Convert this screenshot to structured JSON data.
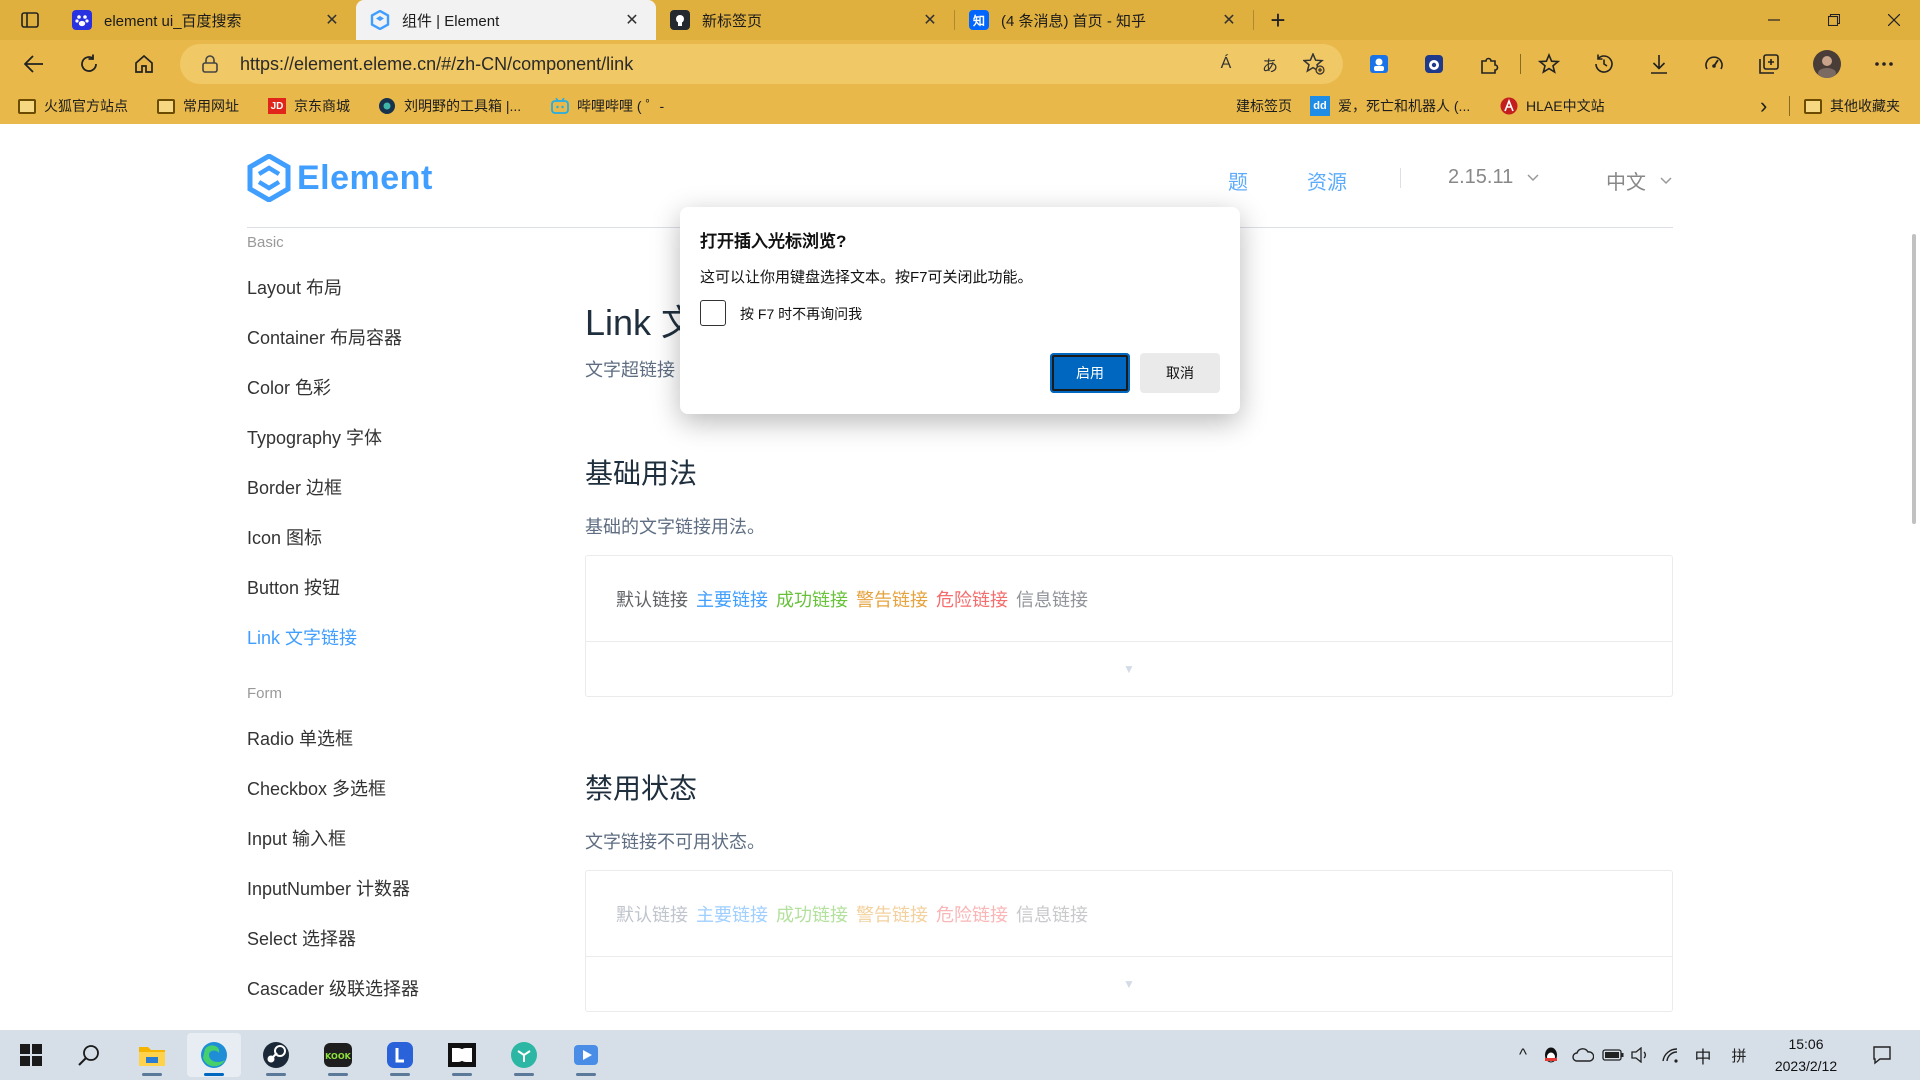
{
  "browser": {
    "tabs": [
      {
        "title": "element ui_百度搜索",
        "favicon": "baidu-paw-icon",
        "color": "#2932e1",
        "active": false
      },
      {
        "title": "组件 | Element",
        "favicon": "element-logo-icon",
        "color": "#409eff",
        "active": true
      },
      {
        "title": "新标签页",
        "favicon": "github-icon",
        "color": "#24292f",
        "active": false
      },
      {
        "title": "(4 条消息) 首页 - 知乎",
        "favicon": "zhihu-icon",
        "color": "#0066ff",
        "active": false
      }
    ],
    "tab_close_glyph": "✕",
    "new_tab_glyph": "+",
    "address": {
      "url": "https://element.eleme.cn/#/zh-CN/component/link"
    },
    "read_aloud_glyph": "Á",
    "translate_glyph": "あ",
    "bookmarks": [
      {
        "label": "火狐官方站点",
        "icon": "folder-icon"
      },
      {
        "label": "常用网址",
        "icon": "folder-icon"
      },
      {
        "label": "京东商城",
        "icon": "jd-icon"
      },
      {
        "label": "刘明野的工具箱 |...",
        "icon": "toolbox-icon"
      },
      {
        "label": "哔哩哔哩 ( ゜-",
        "icon": "bilibili-icon"
      },
      {
        "label": "建标签页",
        "icon": "page-icon"
      },
      {
        "label": "爱，死亡和机器人 (...",
        "icon": "douban-icon"
      },
      {
        "label": "HLAE中文站",
        "icon": "hlae-icon"
      },
      {
        "label": "其他收藏夹",
        "icon": "folder-icon"
      }
    ],
    "bookmarks_more_glyph": "›",
    "accent": "#e8b84a"
  },
  "site": {
    "brand": "Element",
    "header_links": [
      "题",
      "资源"
    ],
    "version": "2.15.11",
    "language": "中文",
    "chevron_glyph": "⌄"
  },
  "sidebar": {
    "groups": [
      {
        "title": "Basic",
        "items": [
          "Layout 布局",
          "Container 布局容器",
          "Color 色彩",
          "Typography 字体",
          "Border 边框",
          "Icon 图标",
          "Button 按钮",
          "Link 文字链接"
        ]
      },
      {
        "title": "Form",
        "items": [
          "Radio 单选框",
          "Checkbox 多选框",
          "Input 输入框",
          "InputNumber 计数器",
          "Select 选择器",
          "Cascader 级联选择器"
        ]
      }
    ],
    "active_item": "Link 文字链接"
  },
  "content": {
    "title": "Link 文字链接",
    "subtitle": "文字超链接",
    "sections": [
      {
        "heading": "基础用法",
        "desc": "基础的文字链接用法。",
        "disabled": false
      },
      {
        "heading": "禁用状态",
        "desc": "文字链接不可用状态。",
        "disabled": true
      }
    ],
    "links": [
      {
        "label": "默认链接",
        "color": "#606266",
        "disabled_color": "#c0c4cc"
      },
      {
        "label": "主要链接",
        "color": "#409eff",
        "disabled_color": "#a0cfff"
      },
      {
        "label": "成功链接",
        "color": "#67c23a",
        "disabled_color": "#b3e19d"
      },
      {
        "label": "警告链接",
        "color": "#e6a23c",
        "disabled_color": "#f3d19e"
      },
      {
        "label": "危险链接",
        "color": "#f56c6c",
        "disabled_color": "#fab6b6"
      },
      {
        "label": "信息链接",
        "color": "#909399",
        "disabled_color": "#c8c9cc"
      }
    ],
    "expand_glyph": "▼"
  },
  "dialog": {
    "title": "打开插入光标浏览?",
    "body": "这可以让你用键盘选择文本。按F7可关闭此功能。",
    "checkbox_label": "按 F7 时不再询问我",
    "checkbox_checked": false,
    "ok_label": "启用",
    "cancel_label": "取消"
  },
  "taskbar": {
    "apps": [
      "file-explorer-icon",
      "edge-icon",
      "steam-icon",
      "kook-icon",
      "lenovo-icon",
      "dolby-icon",
      "app-icon",
      "media-player-icon"
    ],
    "tray_glyphs": {
      "chevron": "^",
      "ime_lang": "中",
      "ime_mode": "拼"
    },
    "time": "15:06",
    "date": "2023/2/12"
  }
}
